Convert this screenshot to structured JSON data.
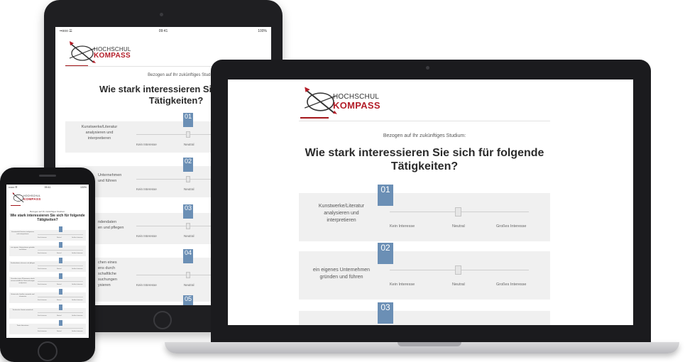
{
  "status_bar": {
    "carrier": "••ooo ☰",
    "time": "09:41",
    "battery": "100%"
  },
  "logo": {
    "line1": "HOCHSCHUL",
    "line2": "KOMPASS"
  },
  "survey": {
    "subtitle": "Bezogen auf Ihr zukünftiges Studium:",
    "question": "Wie stark interessieren Sie sich für folgende Tätigkeiten?",
    "scale": {
      "low": "Kein Interesse",
      "mid": "Neutral",
      "high": "Großes Interesse"
    },
    "items": [
      {
        "number": "01",
        "label": "Kunstwerke/Literatur analysieren und interpretieren"
      },
      {
        "number": "02",
        "label": "ein eigenes Unternehmen gründen und führen"
      },
      {
        "number": "03",
        "label": "Kundendaten erfassen und pflegen"
      },
      {
        "number": "04",
        "label": "Ursachen eines Phänomens durch wissenschaftliche Untersuchungen analysieren"
      },
      {
        "number": "05",
        "label": ""
      }
    ]
  },
  "tablet_fragments": {
    "q_line1": "Wie stark interessieren Sie sich für",
    "q_line2": "Tätigkeiten?",
    "row1": [
      "Kunstwerke/Literatur",
      "analysieren und",
      "interpretieren"
    ],
    "row2": [
      "Unternehmen",
      "und führen"
    ],
    "row3": [
      "ndendaten",
      "en und pflegen"
    ],
    "row4": [
      "chen eines",
      "ens durch",
      "schaftliche",
      "suchungen",
      "ysieren"
    ]
  },
  "laptop_fragments": {
    "q_line1": "Wie stark interessieren Sie sich für folgende",
    "q_line2": "Tätigkeiten?",
    "row1": [
      "Kunstwerke/Literatur",
      "analysieren und",
      "interpretieren"
    ],
    "row2": [
      "ein eigenes Unternehmen",
      "gründen und führen"
    ]
  },
  "phone_fragments": {
    "q_line1": "Wie stark interessieren Sie sich für folgende",
    "q_line2": "Tätigkeiten?",
    "rows": [
      "Kunstwerke/Literatur analysieren und interpretieren",
      "ein eigenes Unternehmen gründen und führen",
      "Kundendaten erfassen und pflegen",
      "Ursachen eines Phänomens durch wissenschaftliche Untersuchungen analysieren",
      "Historische Quellen sammeln und auswerten",
      "Technische Geräte entwickeln",
      "Texte übersetzen"
    ]
  },
  "colors": {
    "accent_red": "#b31d28",
    "badge_blue": "#6b8fb5",
    "row_bg": "#f0f0f0"
  }
}
